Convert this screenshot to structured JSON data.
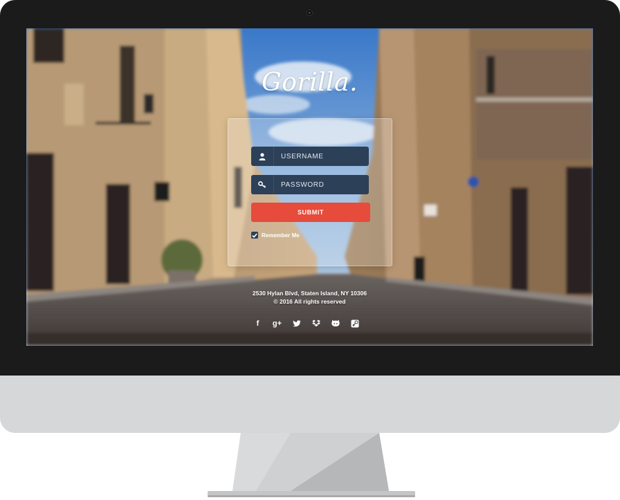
{
  "app": {
    "logo": "Gorilla."
  },
  "login": {
    "username_placeholder": "USERNAME",
    "password_placeholder": "PASSWORD",
    "submit_label": "SUBMIT",
    "remember_label": "Remember Me",
    "remember_checked": true
  },
  "footer": {
    "address": "2530 Hylan Blvd, Staten Island, NY 10306",
    "copyright": "© 2016 All rights reserved"
  },
  "social": [
    {
      "icon": "facebook-icon",
      "glyph": "f"
    },
    {
      "icon": "google-plus-icon",
      "glyph": "g+"
    },
    {
      "icon": "twitter-icon",
      "glyph": ""
    },
    {
      "icon": "dropbox-icon",
      "glyph": ""
    },
    {
      "icon": "github-icon",
      "glyph": ""
    },
    {
      "icon": "steam-icon",
      "glyph": ""
    }
  ],
  "colors": {
    "field_bg": "#2c4058",
    "submit_bg": "#e64b3b",
    "bezel": "#1b1b1b",
    "chin": "#d6d7d9"
  }
}
